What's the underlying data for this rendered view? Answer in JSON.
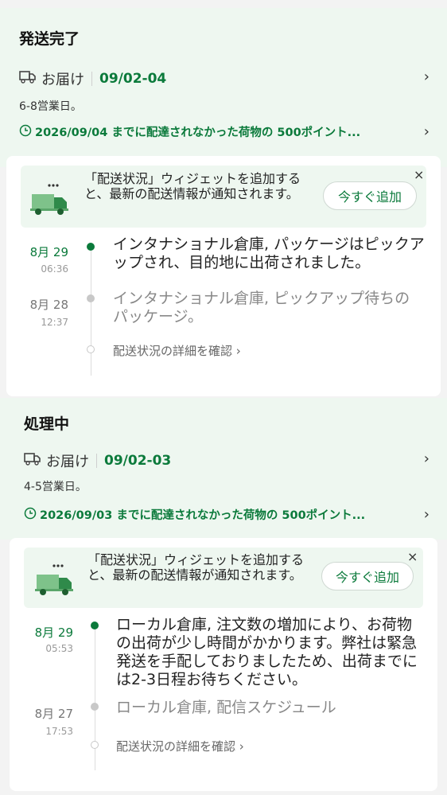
{
  "sections": [
    {
      "title": "発送完了",
      "delivery_label": "お届け",
      "delivery_date": "09/02-04",
      "business_days": "6-8営業日。",
      "guarantee": "2026/09/04 までに配達されなかった荷物の 500ポイント...",
      "widget": {
        "text": "「配送状況」ウィジェットを追加すると、最新の配送情報が通知されます。",
        "button": "今すぐ追加",
        "close": "×"
      },
      "events": [
        {
          "date": "8月 29",
          "time": "06:36",
          "text": "インタナショナル倉庫, パッケージはピックアップされ、目的地に出荷されました。",
          "state": "active"
        },
        {
          "date": "8月 28",
          "time": "12:37",
          "text": "インタナショナル倉庫, ピックアップ待ちのパッケージ。",
          "state": "past"
        }
      ],
      "detail_link": "配送状況の詳細を確認 ›"
    },
    {
      "title": "処理中",
      "delivery_label": "お届け",
      "delivery_date": "09/02-03",
      "business_days": "4-5営業日。",
      "guarantee": "2026/09/03 までに配達されなかった荷物の 500ポイント...",
      "widget": {
        "text": "「配送状況」ウィジェットを追加すると、最新の配送情報が通知されます。",
        "button": "今すぐ追加",
        "close": "×"
      },
      "events": [
        {
          "date": "8月 29",
          "time": "05:53",
          "text": "ローカル倉庫, 注文数の増加により、お荷物の出荷が少し時間がかかります。弊社は緊急発送を手配しておりましたため、出荷までには2-3日程お待ちください。",
          "state": "active"
        },
        {
          "date": "8月 27",
          "time": "17:53",
          "text": "ローカル倉庫, 配信スケジュール",
          "state": "past"
        }
      ],
      "detail_link": "配送状況の詳細を確認 ›"
    }
  ],
  "colors": {
    "accent": "#0b7a3b",
    "header_bg": "#eef7f0"
  }
}
